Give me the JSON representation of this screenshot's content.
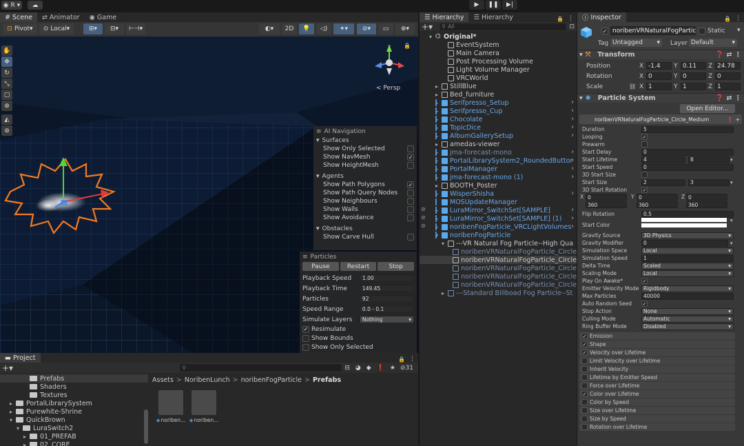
{
  "topbar": {
    "account": "R",
    "account_arrow": "▾"
  },
  "scene_tabs": [
    {
      "label": "Scene",
      "icon": "#"
    },
    {
      "label": "Animator",
      "icon": "⇄"
    },
    {
      "label": "Game",
      "icon": "◉"
    }
  ],
  "scene_toolbar": {
    "pivot": "Pivot",
    "local": "Local",
    "mode_2d": "2D"
  },
  "persp": "< Persp",
  "ai_nav": {
    "title": "AI Navigation",
    "surfaces": "Surfaces",
    "surface_items": [
      {
        "label": "Show Only Selected",
        "checked": false
      },
      {
        "label": "Show NavMesh",
        "checked": true
      },
      {
        "label": "Show HeightMesh",
        "checked": false
      }
    ],
    "agents": "Agents",
    "agent_items": [
      {
        "label": "Show Path Polygons",
        "checked": true
      },
      {
        "label": "Show Path Query Nodes",
        "checked": false
      },
      {
        "label": "Show Neighbours",
        "checked": false
      },
      {
        "label": "Show Walls",
        "checked": false
      },
      {
        "label": "Show Avoidance",
        "checked": false
      }
    ],
    "obstacles": "Obstacles",
    "obstacle_items": [
      {
        "label": "Show Carve Hull",
        "checked": false
      }
    ]
  },
  "particles": {
    "title": "Particles",
    "pause": "Pause",
    "restart": "Restart",
    "stop": "Stop",
    "rows": [
      {
        "label": "Playback Speed",
        "value": "1.00"
      },
      {
        "label": "Playback Time",
        "value": "149.45"
      },
      {
        "label": "Particles",
        "value": "92"
      },
      {
        "label": "Speed Range",
        "value": "0.0 - 0.1"
      },
      {
        "label": "Simulate Layers",
        "value": "Nothing"
      }
    ],
    "checks": [
      {
        "label": "Resimulate",
        "checked": true
      },
      {
        "label": "Show Bounds",
        "checked": false
      },
      {
        "label": "Show Only Selected",
        "checked": false
      }
    ]
  },
  "hierarchy": {
    "tab1": "Hierarchy",
    "tab2": "Hierarchy",
    "search_placeholder": "All",
    "rows": [
      {
        "label": "Original*",
        "indent": 0,
        "type": "scene",
        "style": "normal",
        "arrow": "▾"
      },
      {
        "label": "EventSystem",
        "indent": 2,
        "type": "obj",
        "style": "normal",
        "arrow": ""
      },
      {
        "label": "Main Camera",
        "indent": 2,
        "type": "obj",
        "style": "normal",
        "arrow": ""
      },
      {
        "label": "Post Processing Volume",
        "indent": 2,
        "type": "obj",
        "style": "normal",
        "arrow": ""
      },
      {
        "label": "Light Volume Manager",
        "indent": 2,
        "type": "obj",
        "style": "normal",
        "arrow": ""
      },
      {
        "label": "VRCWorld",
        "indent": 2,
        "type": "obj",
        "style": "normal",
        "arrow": ""
      },
      {
        "label": "StillBlue",
        "indent": 1,
        "type": "obj",
        "style": "normal",
        "arrow": "▸"
      },
      {
        "label": "Bed_furniture",
        "indent": 1,
        "type": "obj",
        "style": "normal",
        "arrow": "▸"
      },
      {
        "label": "Serifpresso_Setup",
        "indent": 1,
        "type": "prefab",
        "style": "blue",
        "arrow": "▸"
      },
      {
        "label": "Serifpresso_Cup",
        "indent": 1,
        "type": "prefab",
        "style": "blue",
        "arrow": "▸"
      },
      {
        "label": "Chocolate",
        "indent": 1,
        "type": "prefab",
        "style": "blue",
        "arrow": "▸"
      },
      {
        "label": "TopicDice",
        "indent": 1,
        "type": "prefab",
        "style": "blue",
        "arrow": "▸"
      },
      {
        "label": "AlbumGallerySetup",
        "indent": 1,
        "type": "prefab",
        "style": "blue",
        "arrow": "▸"
      },
      {
        "label": "amedas-viewer",
        "indent": 1,
        "type": "obj",
        "style": "normal",
        "arrow": "▸"
      },
      {
        "label": "jma-forecast-mono",
        "indent": 1,
        "type": "prefab",
        "style": "dim",
        "arrow": "▸"
      },
      {
        "label": "PortalLibrarySystem2_RoundedButtor",
        "indent": 1,
        "type": "prefab",
        "style": "blue",
        "arrow": "▸"
      },
      {
        "label": "PortalManager",
        "indent": 1,
        "type": "prefab",
        "style": "blue",
        "arrow": "▸"
      },
      {
        "label": "jma-forecast-mono (1)",
        "indent": 1,
        "type": "prefab",
        "style": "blue",
        "arrow": "▸"
      },
      {
        "label": "BOOTH_Poster",
        "indent": 1,
        "type": "obj",
        "style": "normal",
        "arrow": "▸"
      },
      {
        "label": "WisperShisha",
        "indent": 1,
        "type": "prefab",
        "style": "blue",
        "arrow": "▸"
      },
      {
        "label": "MOSUpdateManager",
        "indent": 1,
        "type": "prefab",
        "style": "blue",
        "arrow": ""
      },
      {
        "label": "LuraMirror_SwitchSet[SAMPLE]",
        "indent": 1,
        "type": "prefab",
        "style": "blue",
        "arrow": "▸"
      },
      {
        "label": "LuraMirror_SwitchSet[SAMPLE] (1)",
        "indent": 1,
        "type": "prefab",
        "style": "blue",
        "arrow": "▸"
      },
      {
        "label": "noribenFogParticle_VRCLightVolumes",
        "indent": 1,
        "type": "prefab",
        "style": "blue",
        "arrow": "▸"
      },
      {
        "label": "noribenFogParticle",
        "indent": 1,
        "type": "prefab",
        "style": "blue",
        "arrow": "▾"
      },
      {
        "label": "---VR Natural Fog Particle--High Qua",
        "indent": 2,
        "type": "obj",
        "style": "normal",
        "arrow": "▾"
      },
      {
        "label": "noribenVRNaturalFogParticle_Circle",
        "indent": 3,
        "type": "obj",
        "style": "dim",
        "arrow": ""
      },
      {
        "label": "noribenVRNaturalFogParticle_Circle",
        "indent": 3,
        "type": "obj",
        "style": "normal",
        "arrow": ""
      },
      {
        "label": "noribenVRNaturalFogParticle_Circle",
        "indent": 3,
        "type": "obj",
        "style": "dim",
        "arrow": ""
      },
      {
        "label": "noribenVRNaturalFogParticle_Circle",
        "indent": 3,
        "type": "obj",
        "style": "dim",
        "arrow": ""
      },
      {
        "label": "noribenVRNaturalFogParticle_Circle",
        "indent": 3,
        "type": "obj",
        "style": "dim",
        "arrow": ""
      },
      {
        "label": "---Standard Billboad Fog Particle--St",
        "indent": 2,
        "type": "obj",
        "style": "dim",
        "arrow": "▸"
      }
    ]
  },
  "inspector": {
    "tab": "Inspector",
    "object_name": "noribenVRNaturalFogPartic",
    "static": "Static",
    "tag_label": "Tag",
    "tag_value": "Untagged",
    "layer_label": "Layer",
    "layer_value": "Default",
    "transform": "Transform",
    "position": {
      "label": "Position",
      "x": "-1.4",
      "y": "0.11",
      "z": "24.78"
    },
    "rotation": {
      "label": "Rotation",
      "x": "0",
      "y": "0",
      "z": "0"
    },
    "scale": {
      "label": "Scale",
      "x": "1",
      "y": "1",
      "z": "1"
    },
    "particle_system": "Particle System",
    "open_editor": "Open Editor...",
    "ps_header": "noribenVRNaturalFogParticle_Circle_Medium",
    "props": [
      {
        "label": "Duration",
        "value": "5",
        "type": "field"
      },
      {
        "label": "Looping",
        "value": "✓",
        "type": "check"
      },
      {
        "label": "Prewarm",
        "value": "",
        "type": "check"
      },
      {
        "label": "Start Delay",
        "value": "0",
        "type": "field"
      },
      {
        "label": "Start Lifetime",
        "value": "4",
        "value2": "8",
        "type": "pair"
      },
      {
        "label": "Start Speed",
        "value": "0",
        "type": "field"
      },
      {
        "label": "3D Start Size",
        "value": "",
        "type": "check"
      },
      {
        "label": "Start Size",
        "value": "2",
        "value2": "3",
        "type": "pair"
      },
      {
        "label": "3D Start Rotation",
        "value": "✓",
        "type": "check"
      }
    ],
    "rot_xyz": {
      "x1": "0",
      "x2": "360",
      "y1": "0",
      "y2": "360",
      "z1": "0",
      "z2": "360"
    },
    "props2": [
      {
        "label": "Flip Rotation",
        "value": "0.5",
        "type": "field"
      },
      {
        "label": "Start Color",
        "value": "",
        "type": "color"
      },
      {
        "label": "Gravity Source",
        "value": "3D Physics",
        "type": "drop"
      },
      {
        "label": "Gravity Modifier",
        "value": "0",
        "type": "dropfield"
      },
      {
        "label": "Simulation Space",
        "value": "Local",
        "type": "drop"
      },
      {
        "label": "Simulation Speed",
        "value": "1",
        "type": "field"
      },
      {
        "label": "Delta Time",
        "value": "Scaled",
        "type": "drop"
      },
      {
        "label": "Scaling Mode",
        "value": "Local",
        "type": "drop"
      },
      {
        "label": "Play On Awake*",
        "value": "✓",
        "type": "check"
      },
      {
        "label": "Emitter Velocity Mode",
        "value": "Rigidbody",
        "type": "drop"
      },
      {
        "label": "Max Particles",
        "value": "40000",
        "type": "field"
      },
      {
        "label": "Auto Random Seed",
        "value": "✓",
        "type": "check"
      },
      {
        "label": "Stop Action",
        "value": "None",
        "type": "drop"
      },
      {
        "label": "Culling Mode",
        "value": "Automatic",
        "type": "drop"
      },
      {
        "label": "Ring Buffer Mode",
        "value": "Disabled",
        "type": "drop"
      }
    ],
    "modules": [
      {
        "label": "Emission",
        "checked": true
      },
      {
        "label": "Shape",
        "checked": true
      },
      {
        "label": "Velocity over Lifetime",
        "checked": true
      },
      {
        "label": "Limit Velocity over Lifetime",
        "checked": false
      },
      {
        "label": "Inherit Velocity",
        "checked": false
      },
      {
        "label": "Lifetime by Emitter Speed",
        "checked": false
      },
      {
        "label": "Force over Lifetime",
        "checked": false
      },
      {
        "label": "Color over Lifetime",
        "checked": true
      },
      {
        "label": "Color by Speed",
        "checked": false
      },
      {
        "label": "Size over Lifetime",
        "checked": false
      },
      {
        "label": "Size by Speed",
        "checked": false
      },
      {
        "label": "Rotation over Lifetime",
        "checked": false
      }
    ]
  },
  "project": {
    "tab": "Project",
    "count": "31",
    "breadcrumb": [
      "Assets",
      "NoribenLunch",
      "noribenFogParticle",
      "Prefabs"
    ],
    "tree": [
      {
        "label": "Prefabs",
        "indent": 3,
        "arrow": ""
      },
      {
        "label": "Shaders",
        "indent": 3,
        "arrow": ""
      },
      {
        "label": "Textures",
        "indent": 3,
        "arrow": ""
      },
      {
        "label": "PortalLibrarySystem",
        "indent": 1,
        "arrow": "▸"
      },
      {
        "label": "Purewhite-Shrine",
        "indent": 1,
        "arrow": "▸"
      },
      {
        "label": "QuickBrown",
        "indent": 1,
        "arrow": "▾"
      },
      {
        "label": "LuraSwitch2",
        "indent": 2,
        "arrow": "▾"
      },
      {
        "label": "01_PREFAB",
        "indent": 3,
        "arrow": "▸"
      },
      {
        "label": "02_CORE",
        "indent": 3,
        "arrow": "▸"
      }
    ],
    "assets": [
      {
        "label": "noriben..."
      },
      {
        "label": "noriben..."
      }
    ]
  }
}
